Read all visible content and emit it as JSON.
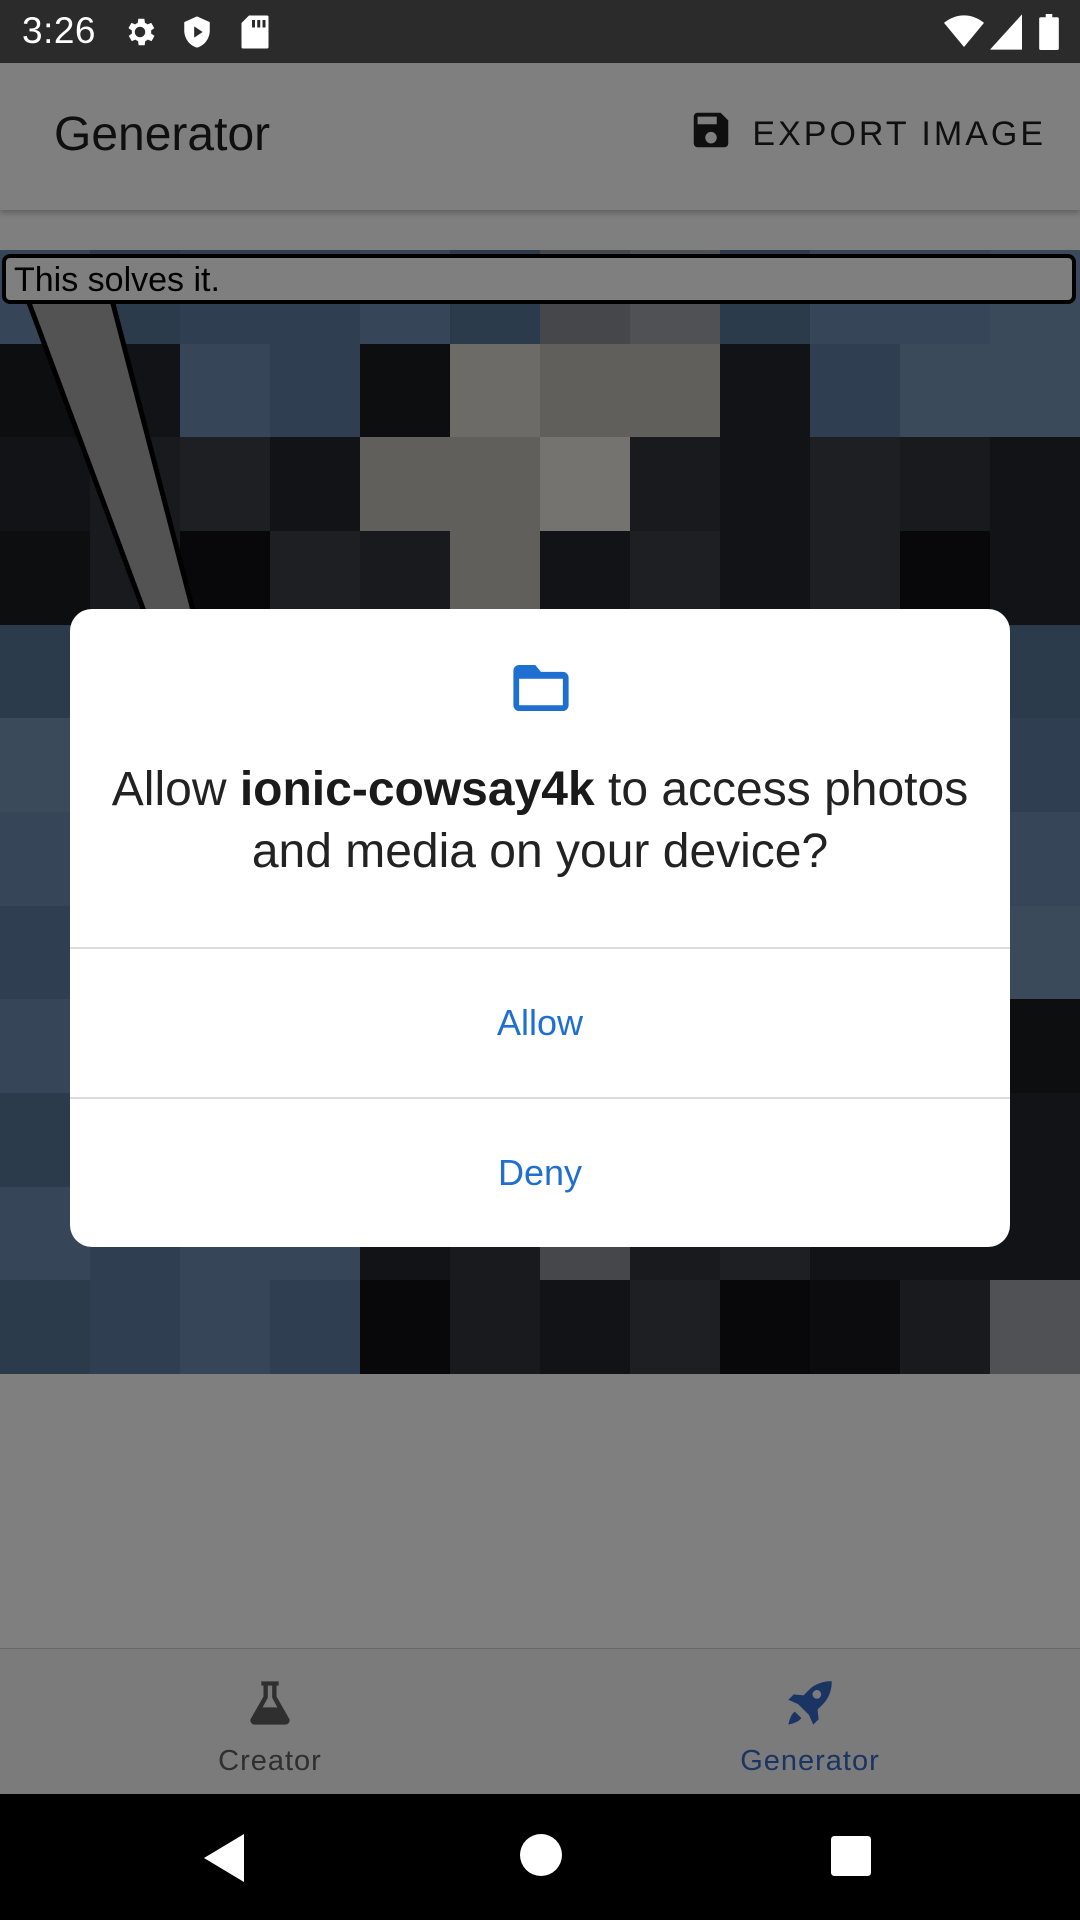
{
  "status_bar": {
    "time": "3:26",
    "icons": [
      "gear-icon",
      "shield-icon",
      "sd-card-icon",
      "wifi-icon",
      "signal-icon",
      "battery-icon"
    ]
  },
  "toolbar": {
    "title": "Generator",
    "export_label": "EXPORT IMAGE",
    "export_icon": "save-icon"
  },
  "content": {
    "caption": "This solves it."
  },
  "tabs": [
    {
      "label": "Creator",
      "icon": "flask-icon",
      "selected": false
    },
    {
      "label": "Generator",
      "icon": "rocket-icon",
      "selected": true
    }
  ],
  "dialog": {
    "icon": "folder-icon",
    "message_prefix": "Allow ",
    "app_name": "ionic-cowsay4k",
    "message_suffix": " to access photos and media on your device?",
    "allow_label": "Allow",
    "deny_label": "Deny"
  },
  "nav_bar": {
    "icons": [
      "back-icon",
      "home-icon",
      "recents-icon"
    ]
  },
  "colors": {
    "accent": "#1f6fd1",
    "tab_selected": "#3468c9",
    "status_bar": "#2b2b2b"
  }
}
